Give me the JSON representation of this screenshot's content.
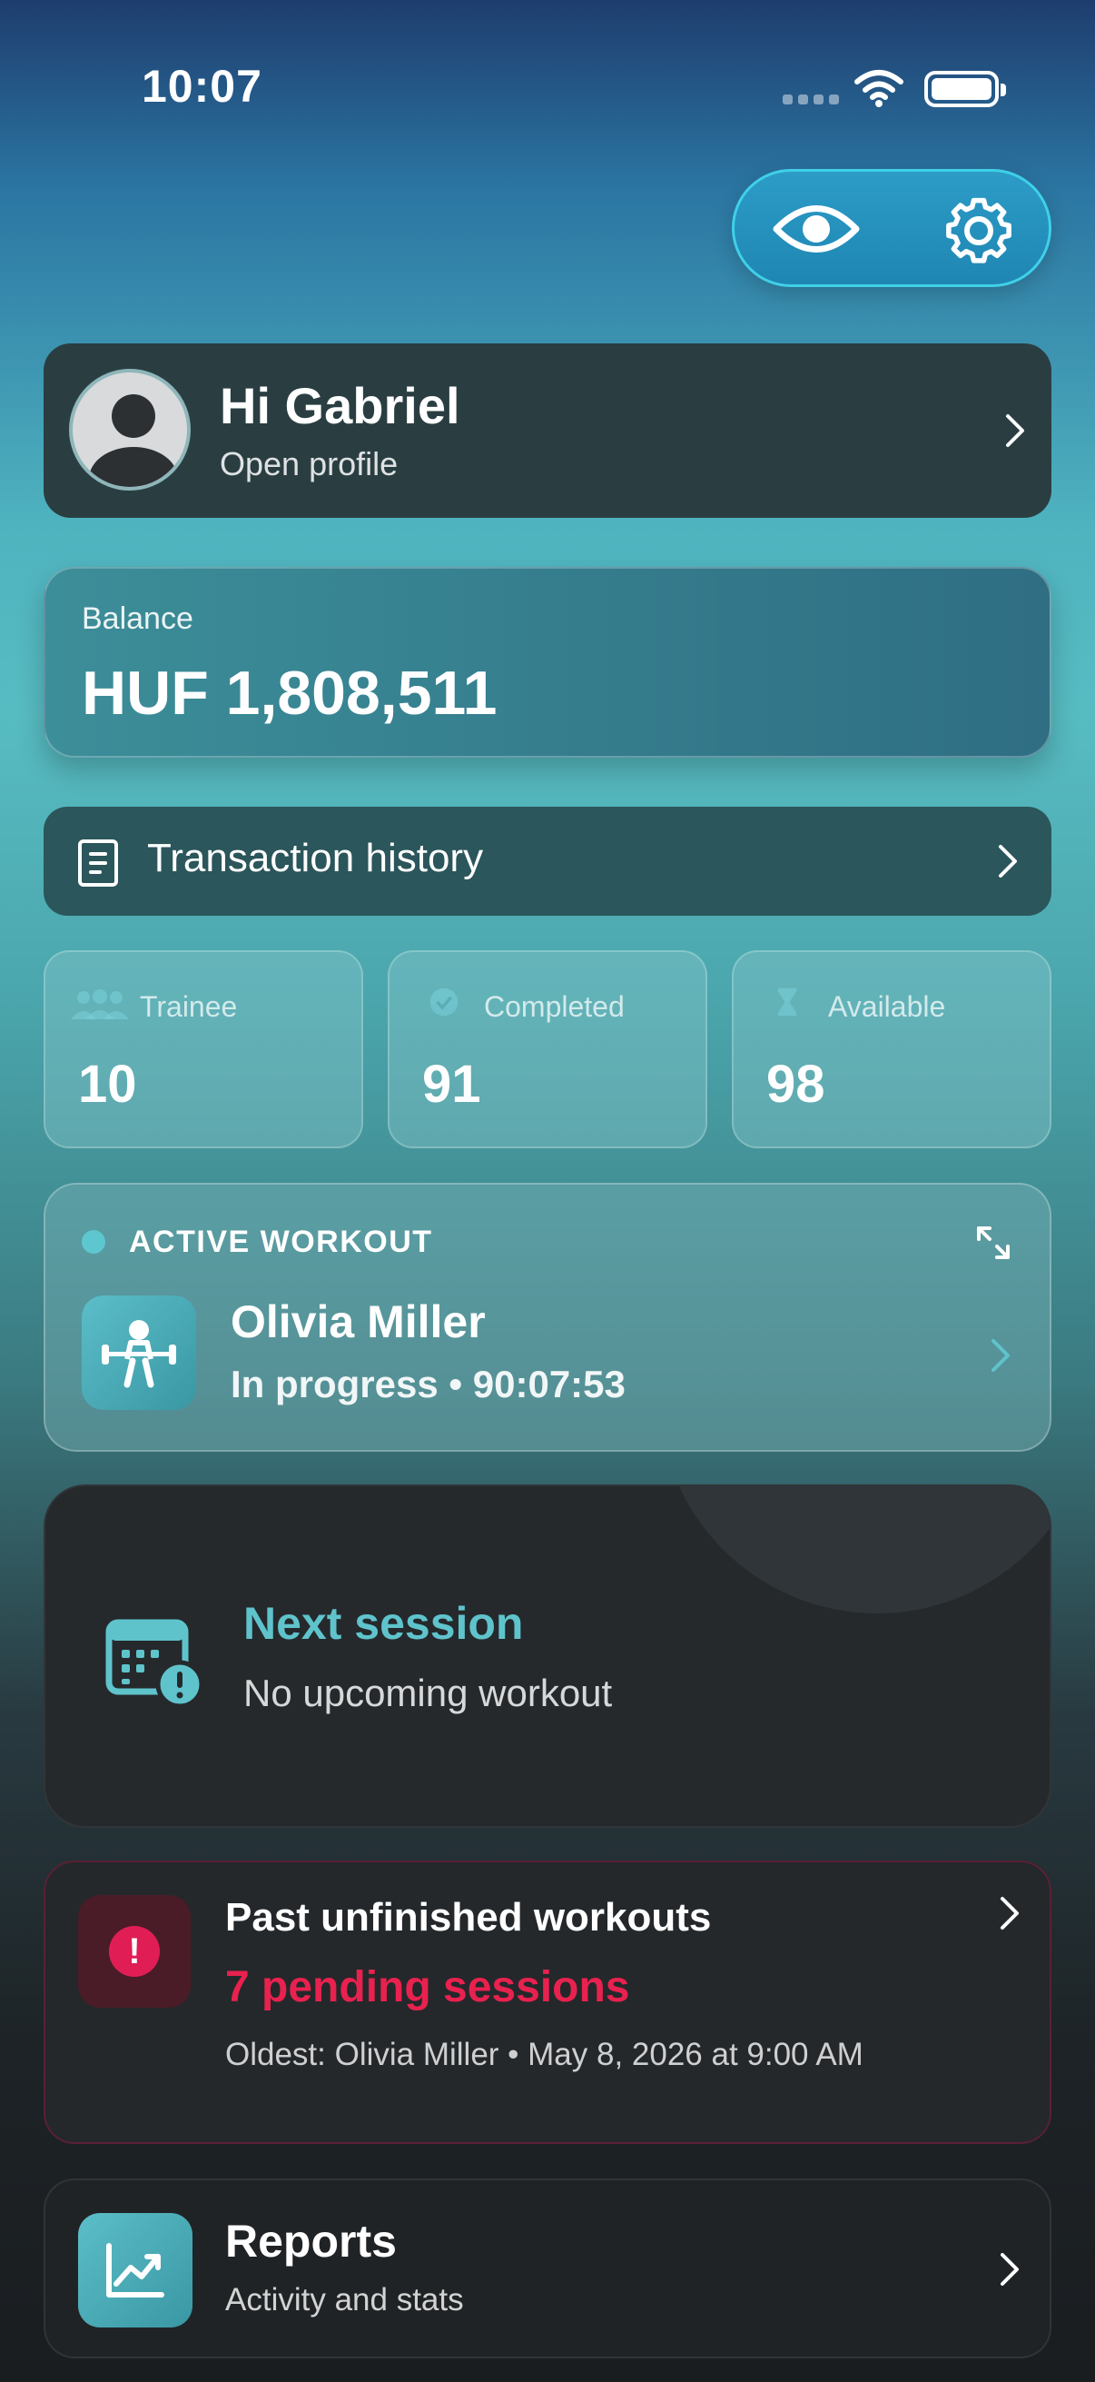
{
  "status_bar": {
    "time": "10:07"
  },
  "header": {
    "visibility_icon": "eye-icon",
    "settings_icon": "gear-icon"
  },
  "profile": {
    "greeting": "Hi Gabriel",
    "link": "Open profile"
  },
  "balance": {
    "label": "Balance",
    "value": "HUF 1,808,511"
  },
  "transactions": {
    "label": "Transaction history"
  },
  "stats": [
    {
      "label": "Trainee",
      "value": "10",
      "icon": "users-icon"
    },
    {
      "label": "Completed",
      "value": "91",
      "icon": "check-circle-icon"
    },
    {
      "label": "Available",
      "value": "98",
      "icon": "hourglass-icon"
    }
  ],
  "active_workout": {
    "title": "ACTIVE WORKOUT",
    "name": "Olivia Miller",
    "status": "In progress • 90:07:53"
  },
  "next_session": {
    "title": "Next session",
    "subtitle": "No upcoming workout"
  },
  "past_unfinished": {
    "title": "Past unfinished workouts",
    "pending": "7 pending sessions",
    "oldest": "Oldest: Olivia Miller • May 8, 2026 at 9:00 AM"
  },
  "reports": {
    "title": "Reports",
    "subtitle": "Activity and stats"
  },
  "colors": {
    "accent_teal": "#5fc3cc",
    "alert_red": "#e8214f",
    "card_dark": "#25292c"
  }
}
